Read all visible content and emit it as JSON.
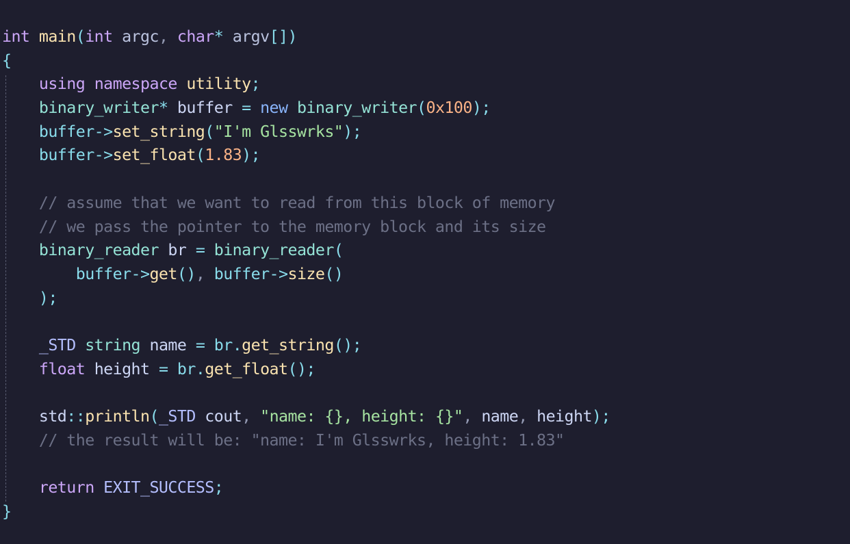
{
  "editor": {
    "theme": {
      "background": "#1e1e2e",
      "foreground": "#cdd6f4",
      "keyword": "#cba6f7",
      "type": "#94e2d5",
      "function": "#f9e2af",
      "number": "#fab387",
      "string": "#a6e3a1",
      "comment": "#6c7086"
    },
    "lines": [
      [
        [
          "tok-kw-purple",
          "int"
        ],
        [
          "tok-plain",
          " "
        ],
        [
          "tok-fn",
          "main"
        ],
        [
          "tok-op",
          "("
        ],
        [
          "tok-kw-purple",
          "int"
        ],
        [
          "tok-plain",
          " "
        ],
        [
          "tok-param",
          "argc"
        ],
        [
          "tok-punct",
          ", "
        ],
        [
          "tok-kw-purple",
          "char"
        ],
        [
          "tok-op",
          "*"
        ],
        [
          "tok-plain",
          " "
        ],
        [
          "tok-param",
          "argv"
        ],
        [
          "tok-op",
          "[])"
        ]
      ],
      [
        [
          "tok-op",
          "{"
        ]
      ],
      [
        [
          "tok-plain",
          "    "
        ],
        [
          "tok-kw-purple",
          "using"
        ],
        [
          "tok-plain",
          " "
        ],
        [
          "tok-kw-purple",
          "namespace"
        ],
        [
          "tok-plain",
          " "
        ],
        [
          "tok-fn",
          "utility"
        ],
        [
          "tok-op",
          ";"
        ]
      ],
      [
        [
          "tok-plain",
          "    "
        ],
        [
          "tok-type",
          "binary_writer"
        ],
        [
          "tok-op",
          "*"
        ],
        [
          "tok-plain",
          " "
        ],
        [
          "tok-var",
          "buffer"
        ],
        [
          "tok-plain",
          " "
        ],
        [
          "tok-op",
          "="
        ],
        [
          "tok-plain",
          " "
        ],
        [
          "tok-kw-blue",
          "new"
        ],
        [
          "tok-plain",
          " "
        ],
        [
          "tok-type",
          "binary_writer"
        ],
        [
          "tok-op",
          "("
        ],
        [
          "tok-num",
          "0x100"
        ],
        [
          "tok-op",
          ");"
        ]
      ],
      [
        [
          "tok-plain",
          "    "
        ],
        [
          "tok-member",
          "buffer"
        ],
        [
          "tok-op",
          "->"
        ],
        [
          "tok-fn",
          "set_string"
        ],
        [
          "tok-op",
          "("
        ],
        [
          "tok-str",
          "\"I'm Glsswrks\""
        ],
        [
          "tok-op",
          ");"
        ]
      ],
      [
        [
          "tok-plain",
          "    "
        ],
        [
          "tok-member",
          "buffer"
        ],
        [
          "tok-op",
          "->"
        ],
        [
          "tok-fn",
          "set_float"
        ],
        [
          "tok-op",
          "("
        ],
        [
          "tok-num",
          "1.83"
        ],
        [
          "tok-op",
          ");"
        ]
      ],
      [],
      [
        [
          "tok-plain",
          "    "
        ],
        [
          "tok-comment",
          "// assume that we want to read from this block of memory"
        ]
      ],
      [
        [
          "tok-plain",
          "    "
        ],
        [
          "tok-comment",
          "// we pass the pointer to the memory block and its size"
        ]
      ],
      [
        [
          "tok-plain",
          "    "
        ],
        [
          "tok-type",
          "binary_reader"
        ],
        [
          "tok-plain",
          " "
        ],
        [
          "tok-var",
          "br"
        ],
        [
          "tok-plain",
          " "
        ],
        [
          "tok-op",
          "="
        ],
        [
          "tok-plain",
          " "
        ],
        [
          "tok-type",
          "binary_reader"
        ],
        [
          "tok-op",
          "("
        ]
      ],
      [
        [
          "tok-plain",
          "        "
        ],
        [
          "tok-member",
          "buffer"
        ],
        [
          "tok-op",
          "->"
        ],
        [
          "tok-fn",
          "get"
        ],
        [
          "tok-op",
          "()"
        ],
        [
          "tok-punct",
          ", "
        ],
        [
          "tok-member",
          "buffer"
        ],
        [
          "tok-op",
          "->"
        ],
        [
          "tok-fn",
          "size"
        ],
        [
          "tok-op",
          "()"
        ]
      ],
      [
        [
          "tok-plain",
          "    "
        ],
        [
          "tok-op",
          ");"
        ]
      ],
      [],
      [
        [
          "tok-plain",
          "    "
        ],
        [
          "tok-macro",
          "_STD"
        ],
        [
          "tok-plain",
          " "
        ],
        [
          "tok-type",
          "string"
        ],
        [
          "tok-plain",
          " "
        ],
        [
          "tok-var",
          "name"
        ],
        [
          "tok-plain",
          " "
        ],
        [
          "tok-op",
          "="
        ],
        [
          "tok-plain",
          " "
        ],
        [
          "tok-member",
          "br"
        ],
        [
          "tok-op",
          "."
        ],
        [
          "tok-fn",
          "get_string"
        ],
        [
          "tok-op",
          "();"
        ]
      ],
      [
        [
          "tok-plain",
          "    "
        ],
        [
          "tok-kw-purple",
          "float"
        ],
        [
          "tok-plain",
          " "
        ],
        [
          "tok-var",
          "height"
        ],
        [
          "tok-plain",
          " "
        ],
        [
          "tok-op",
          "="
        ],
        [
          "tok-plain",
          " "
        ],
        [
          "tok-member",
          "br"
        ],
        [
          "tok-op",
          "."
        ],
        [
          "tok-fn",
          "get_float"
        ],
        [
          "tok-op",
          "();"
        ]
      ],
      [],
      [
        [
          "tok-plain",
          "    "
        ],
        [
          "tok-plain",
          "std"
        ],
        [
          "tok-op",
          "::"
        ],
        [
          "tok-fn",
          "println"
        ],
        [
          "tok-op",
          "("
        ],
        [
          "tok-macro",
          "_STD"
        ],
        [
          "tok-plain",
          " "
        ],
        [
          "tok-plain",
          "cout"
        ],
        [
          "tok-punct",
          ", "
        ],
        [
          "tok-str",
          "\"name: {}, height: {}\""
        ],
        [
          "tok-punct",
          ", "
        ],
        [
          "tok-var",
          "name"
        ],
        [
          "tok-punct",
          ", "
        ],
        [
          "tok-var",
          "height"
        ],
        [
          "tok-op",
          ");"
        ]
      ],
      [
        [
          "tok-plain",
          "    "
        ],
        [
          "tok-comment",
          "// the result will be: \"name: I'm Glsswrks, height: 1.83\""
        ]
      ],
      [],
      [
        [
          "tok-plain",
          "    "
        ],
        [
          "tok-kw-purple",
          "return"
        ],
        [
          "tok-plain",
          " "
        ],
        [
          "tok-macro",
          "EXIT_SUCCESS"
        ],
        [
          "tok-op",
          ";"
        ]
      ],
      [
        [
          "tok-op",
          "}"
        ]
      ]
    ]
  }
}
